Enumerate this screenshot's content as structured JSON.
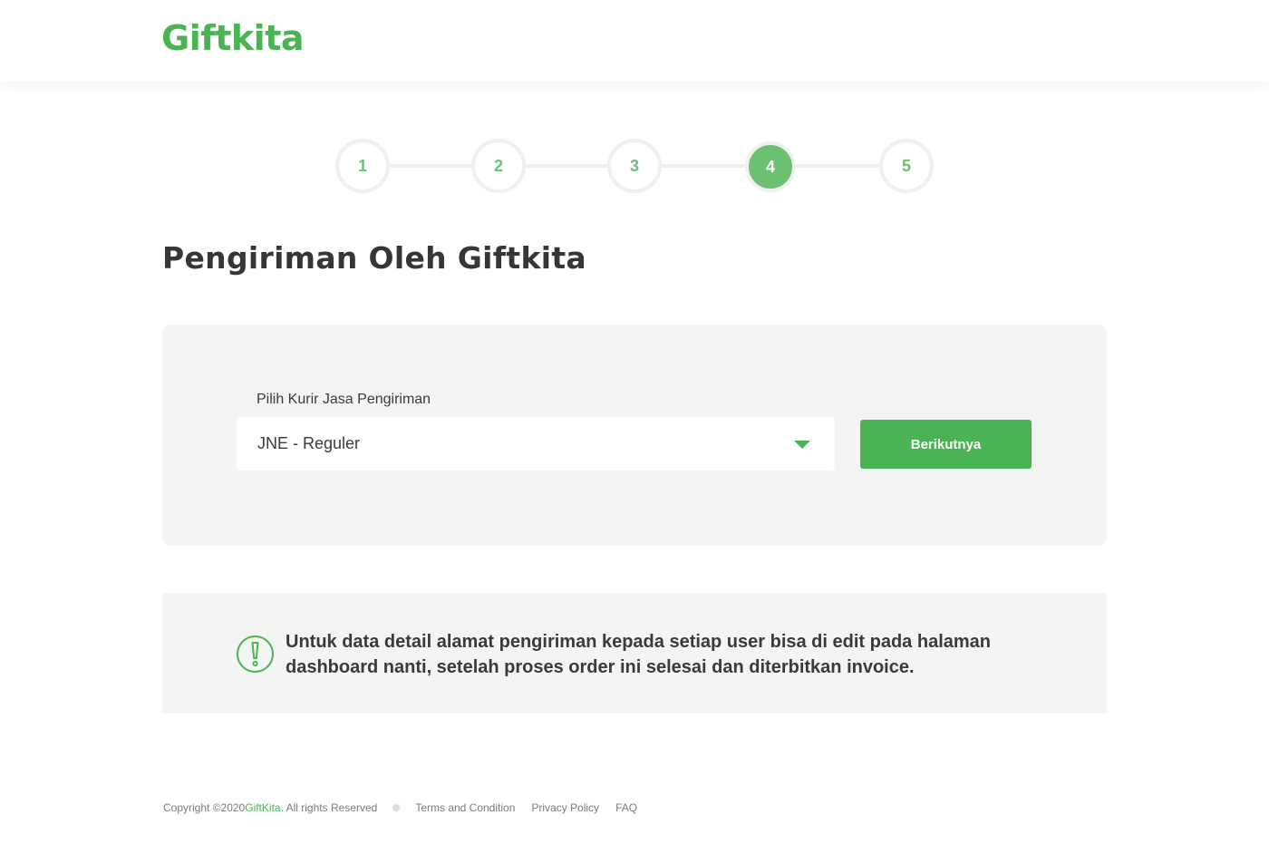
{
  "header": {
    "logo_text": "Giftkita"
  },
  "stepper": {
    "steps": [
      {
        "label": "1"
      },
      {
        "label": "2"
      },
      {
        "label": "3"
      },
      {
        "label": "4"
      },
      {
        "label": "5"
      }
    ],
    "active_step": "4",
    "accent_color": "#4bb353"
  },
  "main": {
    "title": "Pengiriman Oleh Giftkita",
    "form": {
      "courier_label": "Pilih Kurir Jasa Pengiriman",
      "courier_value": "JNE - Reguler",
      "next_button_label": "Berikutnya"
    },
    "info": {
      "icon": "exclamation-circle-icon",
      "text": "Untuk data detail alamat pengiriman kepada setiap user bisa di edit pada halaman dashboard nanti, setelah proses order ini selesai dan diterbitkan invoice."
    }
  },
  "footer": {
    "copyright_prefix": "Copyright ©2020 ",
    "brand": "GiftKita",
    "copyright_suffix": ". All rights Reserved",
    "links": {
      "terms": "Terms and Condition",
      "privacy": "Privacy Policy",
      "faq": "FAQ"
    }
  }
}
